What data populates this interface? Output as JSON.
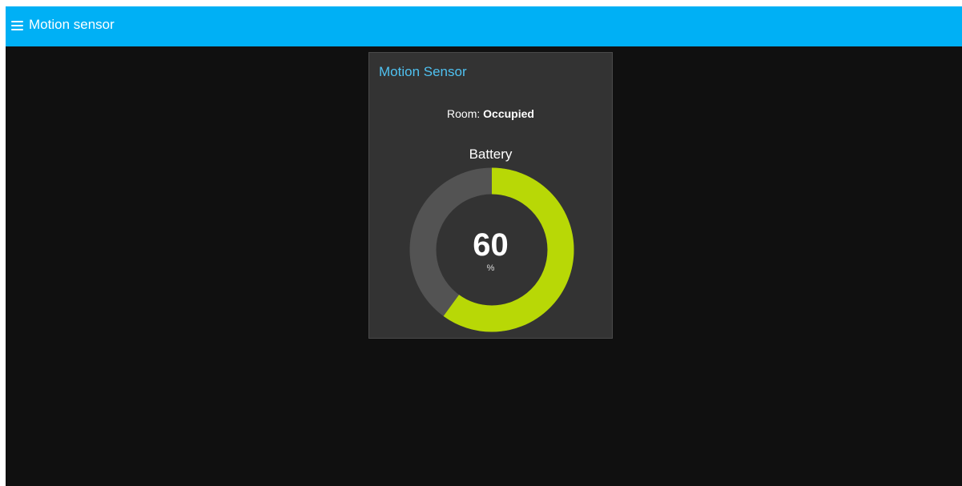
{
  "header": {
    "title": "Motion sensor",
    "menu_icon": "hamburger-menu-icon"
  },
  "card": {
    "title": "Motion Sensor",
    "room_label": "Room: ",
    "room_value": "Occupied",
    "gauge": {
      "title": "Battery",
      "value": "60",
      "level": 60,
      "max": 100,
      "unit": "%"
    }
  },
  "colors": {
    "header_bg": "#00b0f5",
    "page_bg": "#101010",
    "card_bg": "#333333",
    "card_title": "#4fc1f0",
    "gauge_fill": "#b8d806",
    "gauge_track": "#535353"
  }
}
